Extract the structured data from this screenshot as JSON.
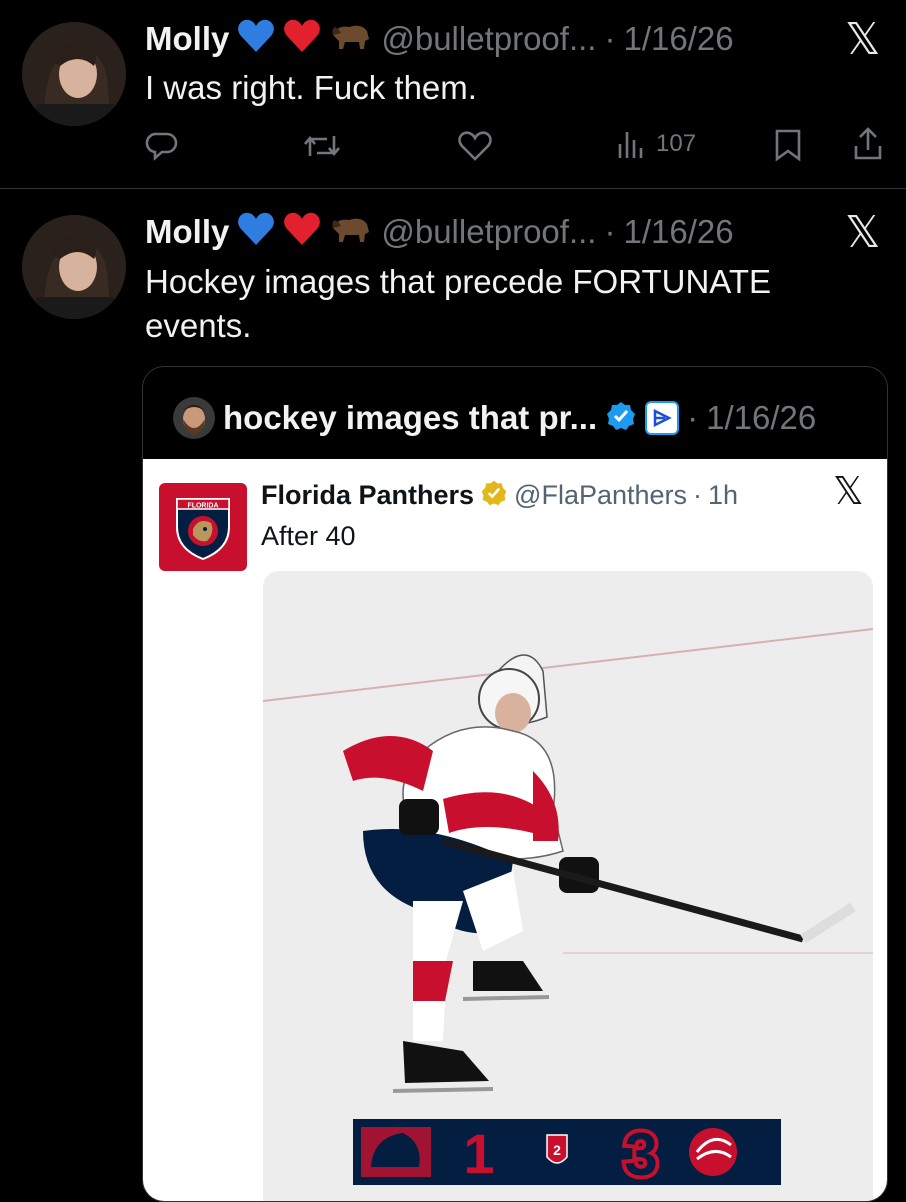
{
  "tweet1": {
    "name": "Molly",
    "handle": "@bulletproof...",
    "date": "1/16/26",
    "separator": "·",
    "text": "I was right. Fuck them.",
    "views": "107",
    "icons": [
      "reply-icon",
      "retweet-icon",
      "like-icon",
      "views-icon",
      "bookmark-icon",
      "share-icon"
    ]
  },
  "tweet2": {
    "name": "Molly",
    "handle": "@bulletproof...",
    "date": "1/16/26",
    "separator": "·",
    "text": "Hockey images that precede FORTUNATE events."
  },
  "quote": {
    "name": "hockey images that pr...",
    "date": "1/16/26",
    "separator": "·",
    "embedded": {
      "name": "Florida Panthers",
      "handle": "@FlaPanthers",
      "time": "1h",
      "separator": "·",
      "text": "After 40",
      "logo_text": "FLORIDA",
      "score": {
        "home": "1",
        "away": "3",
        "period": "2"
      }
    }
  },
  "colors": {
    "background": "#000000",
    "muted": "#71767b",
    "verified_blue": "#1d9bf0",
    "verified_gold": "#e2b719",
    "panthers_red": "#c8102e",
    "panthers_navy": "#041e42"
  }
}
